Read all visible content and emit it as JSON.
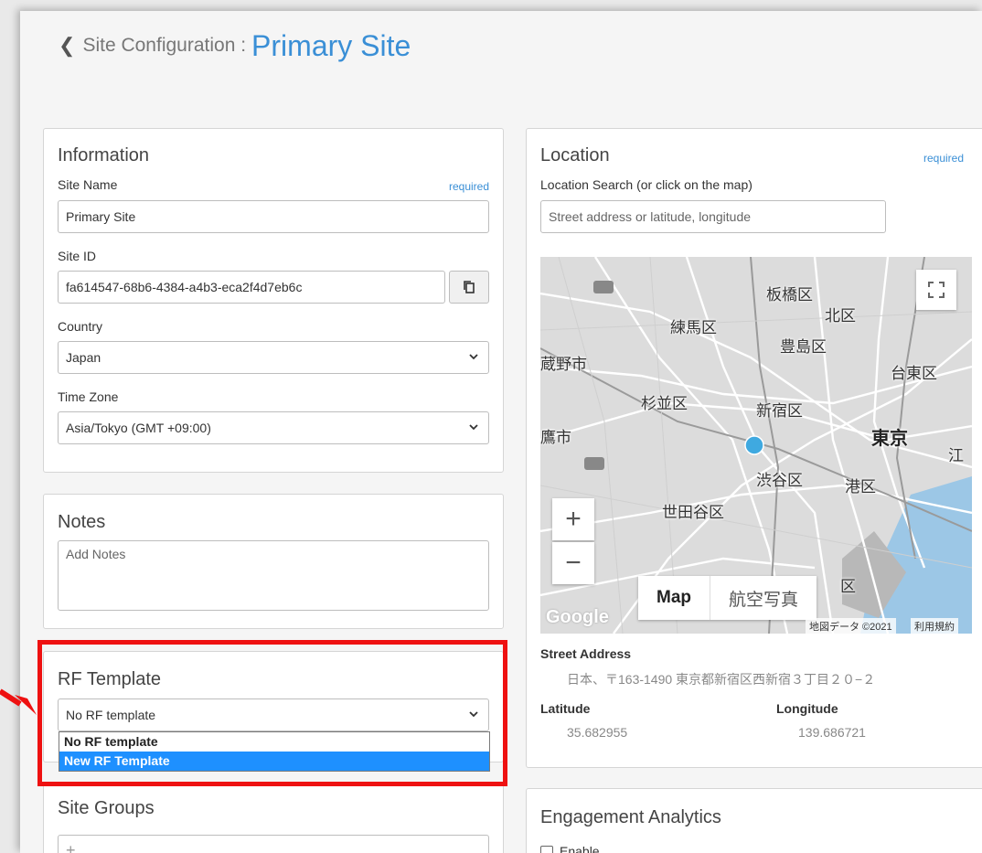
{
  "header": {
    "back_icon": "chevron-left-icon",
    "breadcrumb": "Site Configuration :",
    "title": "Primary Site"
  },
  "information": {
    "title": "Information",
    "site_name_label": "Site Name",
    "required": "required",
    "site_name_value": "Primary Site",
    "site_id_label": "Site ID",
    "site_id_value": "fa614547-68b6-4384-a4b3-eca2f4d7eb6c",
    "copy_icon": "copy-icon",
    "country_label": "Country",
    "country_value": "Japan",
    "timezone_label": "Time Zone",
    "timezone_value": "Asia/Tokyo (GMT +09:00)"
  },
  "notes": {
    "title": "Notes",
    "placeholder": "Add Notes"
  },
  "rf_template": {
    "title": "RF Template",
    "selected": "No RF template",
    "options": [
      "No RF template",
      "New RF Template"
    ]
  },
  "site_groups": {
    "title": "Site Groups",
    "add_glyph": "+"
  },
  "location": {
    "title": "Location",
    "required": "required",
    "search_label": "Location Search (or click on the map)",
    "search_placeholder": "Street address or latitude, longitude",
    "map": {
      "labels": [
        "板橋区",
        "北区",
        "練馬区",
        "豊島区",
        "蔵野市",
        "台東区",
        "杉並区",
        "新宿区",
        "東京",
        "鷹市",
        "江",
        "渋谷区",
        "港区",
        "世田谷区",
        "区"
      ],
      "zoom_in": "+",
      "zoom_out": "−",
      "type_map": "Map",
      "type_satellite": "航空写真",
      "footer_data": "地図データ ©2021",
      "footer_terms": "利用規約",
      "google": "Google",
      "fullscreen_icon": "fullscreen-icon"
    },
    "street_address_label": "Street Address",
    "street_address_value": "日本、〒163-1490 東京都新宿区西新宿３丁目２０−２",
    "latitude_label": "Latitude",
    "latitude_value": "35.682955",
    "longitude_label": "Longitude",
    "longitude_value": "139.686721"
  },
  "engagement": {
    "title": "Engagement Analytics",
    "enable_label": "Enable"
  },
  "annotation": {
    "arrow_color": "#ee1111",
    "highlight_color": "#ee1111"
  }
}
